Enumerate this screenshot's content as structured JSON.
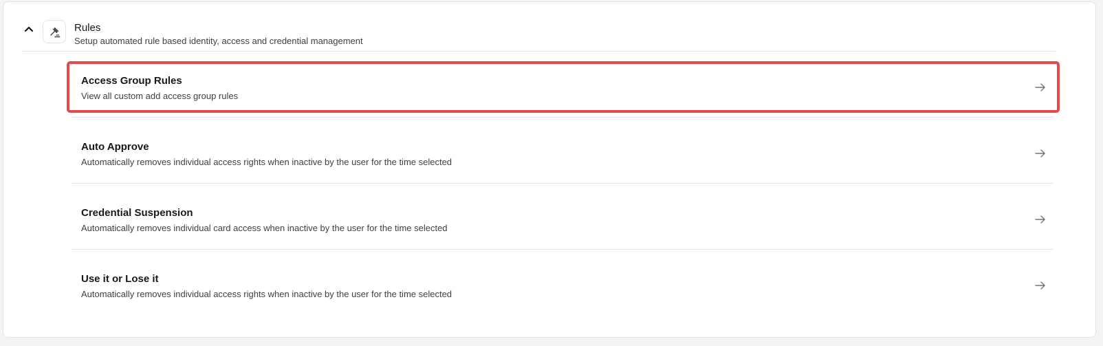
{
  "section": {
    "title": "Rules",
    "subtitle": "Setup automated rule based identity, access and credential management",
    "icon": "gavel-icon",
    "collapse_icon": "chevron-up-icon"
  },
  "rules": [
    {
      "title": "Access Group Rules",
      "description": "View all custom add access group rules",
      "icon": "arrow-right-icon",
      "highlighted": true
    },
    {
      "title": "Auto Approve",
      "description": "Automatically removes individual access rights when inactive by the user for the time selected",
      "icon": "arrow-right-icon"
    },
    {
      "title": "Credential Suspension",
      "description": "Automatically removes individual card access when inactive by the user for the time selected",
      "icon": "arrow-right-icon"
    },
    {
      "title": "Use it or Lose it",
      "description": "Automatically removes individual access rights when inactive by the user for the time selected",
      "icon": "arrow-right-icon"
    }
  ],
  "colors": {
    "highlight": "#e5484d",
    "border": "#e4e4e7",
    "text_primary": "#18181b",
    "text_secondary": "#3f3f46",
    "arrow": "#71717a"
  }
}
